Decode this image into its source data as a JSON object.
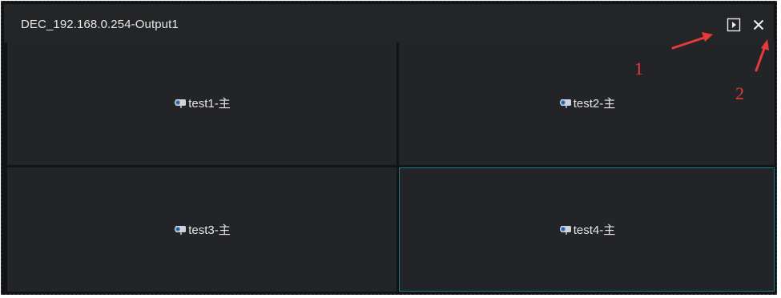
{
  "window": {
    "title": "DEC_192.168.0.254-Output1",
    "buttons": {
      "play": "play-icon",
      "close": "close-icon"
    }
  },
  "grid": {
    "cells": [
      {
        "label": "test1-主",
        "icon": "camera-icon",
        "selected": false
      },
      {
        "label": "test2-主",
        "icon": "camera-icon",
        "selected": false
      },
      {
        "label": "test3-主",
        "icon": "camera-icon",
        "selected": false
      },
      {
        "label": "test4-主",
        "icon": "camera-icon",
        "selected": true
      }
    ]
  },
  "annotations": {
    "marker_1": "1",
    "marker_2": "2",
    "color": "#e83a3a"
  },
  "colors": {
    "titlebar": "#242527",
    "cell": "#232427",
    "selected_border": "#1d7a82"
  }
}
